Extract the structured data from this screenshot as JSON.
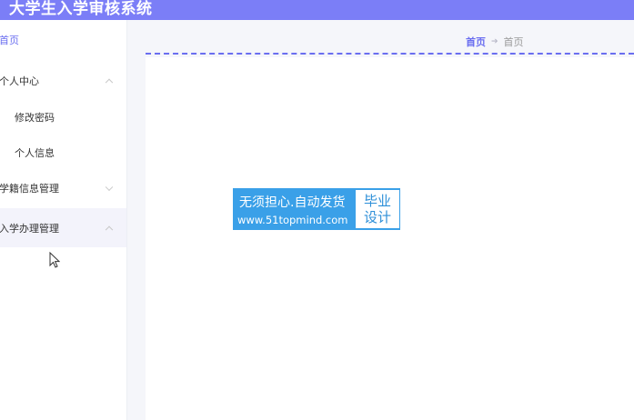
{
  "app": {
    "title": "大学生入学审核系统"
  },
  "sidebar": {
    "home": "首页",
    "groups": [
      {
        "label": "个人中心",
        "expanded": true,
        "items": [
          {
            "label": "修改密码"
          },
          {
            "label": "个人信息"
          }
        ]
      },
      {
        "label": "学籍信息管理",
        "expanded": false
      },
      {
        "label": "入学办理管理",
        "expanded": false
      }
    ]
  },
  "breadcrumb": {
    "first": "首页",
    "separator_icon": "arrow-icon",
    "last": "首页"
  },
  "watermark": {
    "line1": "无须担心.自动发货",
    "line2": "www.51topmind.com",
    "badge_line1": "毕业",
    "badge_line2": "设计"
  },
  "colors": {
    "accent": "#7b7ef7",
    "link": "#6a6ef0",
    "watermark_bg": "#3aa0e8"
  }
}
